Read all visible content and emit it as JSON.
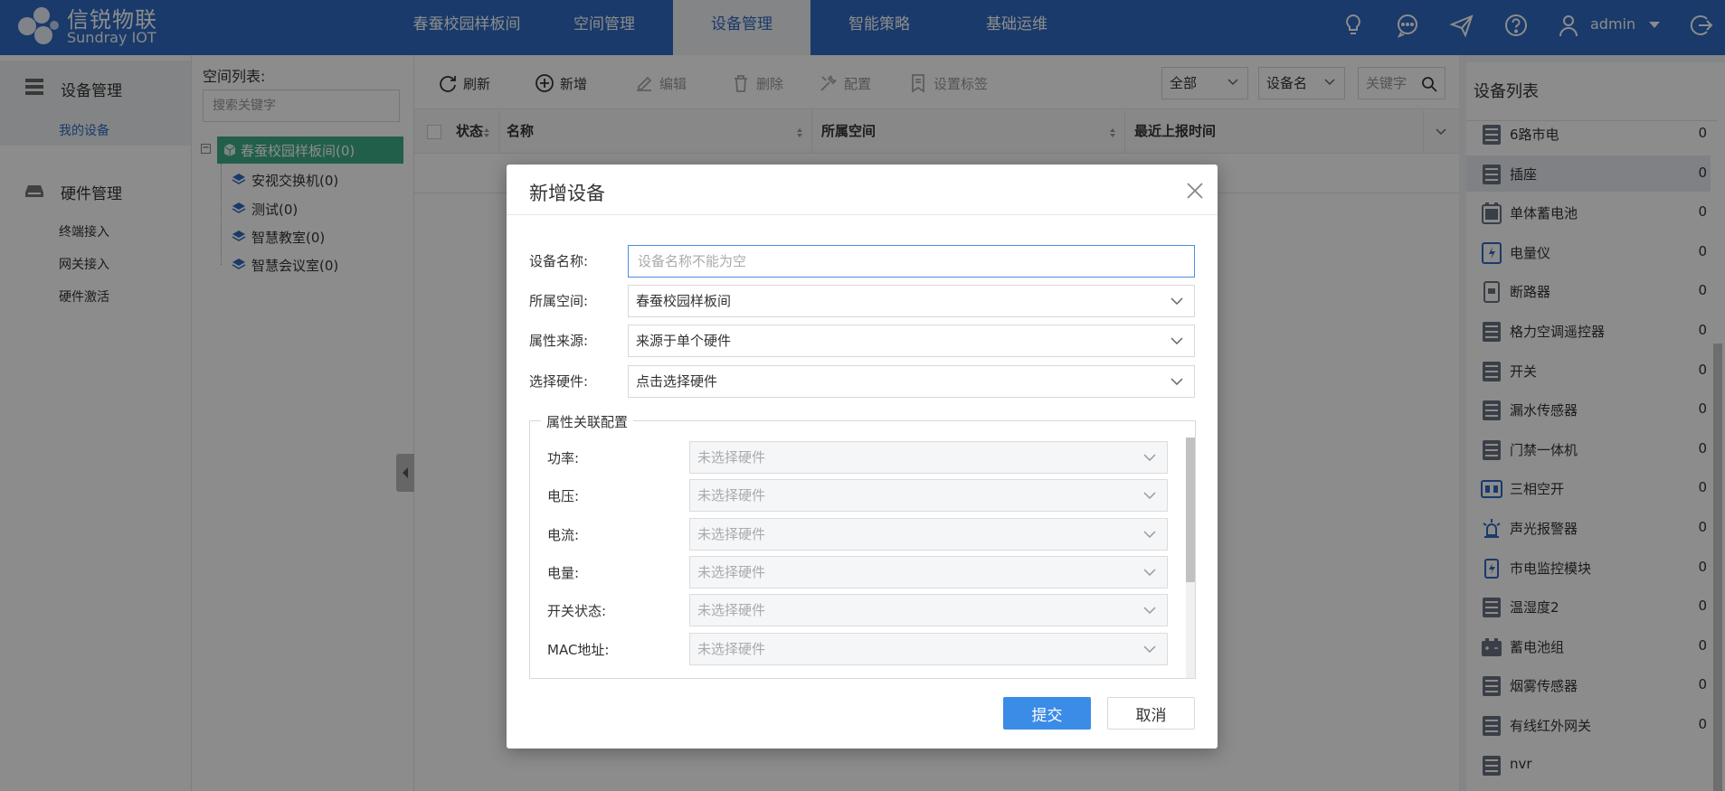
{
  "brand": {
    "name_cn": "信锐物联",
    "name_en": "Sundray IOT"
  },
  "nav": {
    "items": [
      "春蚕校园样板间",
      "空间管理",
      "设备管理",
      "智能策略",
      "基础运维"
    ],
    "active_index": 2
  },
  "user": {
    "name": "admin"
  },
  "sidebar": {
    "groups": [
      {
        "label": "设备管理",
        "icon": "list-icon",
        "items": [
          "我的设备"
        ]
      },
      {
        "label": "硬件管理",
        "icon": "hardware-icon",
        "items": [
          "终端接入",
          "网关接入",
          "硬件激活"
        ]
      }
    ],
    "active_item": "我的设备"
  },
  "space_tree": {
    "title": "空间列表:",
    "search_placeholder": "搜索关键字",
    "root": "春蚕校园样板间(0)",
    "children": [
      "安视交换机(0)",
      "测试(0)",
      "智慧教室(0)",
      "智慧会议室(0)"
    ]
  },
  "toolbar": {
    "refresh": "刷新",
    "add": "新增",
    "edit": "编辑",
    "delete": "删除",
    "config": "配置",
    "set_tag": "设置标签",
    "filter_all": "全部",
    "filter_field": "设备名",
    "keyword_placeholder": "关键字"
  },
  "grid": {
    "columns": [
      "状态",
      "名称",
      "所属空间",
      "最近上报时间"
    ]
  },
  "device_list": {
    "title": "设备列表",
    "items": [
      {
        "label": "6路市电",
        "count": "0",
        "icon": "server-icon"
      },
      {
        "label": "插座",
        "count": "0",
        "icon": "server-icon",
        "active": true
      },
      {
        "label": "单体蓄电池",
        "count": "0",
        "icon": "battery-icon"
      },
      {
        "label": "电量仪",
        "count": "0",
        "icon": "meter-icon"
      },
      {
        "label": "断路器",
        "count": "0",
        "icon": "breaker-icon"
      },
      {
        "label": "格力空调遥控器",
        "count": "0",
        "icon": "server-icon"
      },
      {
        "label": "开关",
        "count": "0",
        "icon": "server-icon"
      },
      {
        "label": "漏水传感器",
        "count": "0",
        "icon": "server-icon"
      },
      {
        "label": "门禁一体机",
        "count": "0",
        "icon": "server-icon"
      },
      {
        "label": "三相空开",
        "count": "0",
        "icon": "switch-icon"
      },
      {
        "label": "声光报警器",
        "count": "0",
        "icon": "alarm-icon"
      },
      {
        "label": "市电监控模块",
        "count": "0",
        "icon": "power-module-icon"
      },
      {
        "label": "温湿度2",
        "count": "0",
        "icon": "server-icon"
      },
      {
        "label": "蓄电池组",
        "count": "0",
        "icon": "battery-group-icon"
      },
      {
        "label": "烟雾传感器",
        "count": "0",
        "icon": "server-icon"
      },
      {
        "label": "有线红外网关",
        "count": "0",
        "icon": "server-icon"
      },
      {
        "label": "nvr",
        "count": "",
        "icon": "server-icon"
      }
    ]
  },
  "modal": {
    "title": "新增设备",
    "fields": {
      "device_name_label": "设备名称:",
      "device_name_placeholder": "设备名称不能为空",
      "space_label": "所属空间:",
      "space_value": "春蚕校园样板间",
      "source_label": "属性来源:",
      "source_value": "来源于单个硬件",
      "hardware_label": "选择硬件:",
      "hardware_value": "点击选择硬件"
    },
    "attr_config": {
      "legend": "属性关联配置",
      "rows": [
        {
          "label": "功率:",
          "value": "未选择硬件"
        },
        {
          "label": "电压:",
          "value": "未选择硬件"
        },
        {
          "label": "电流:",
          "value": "未选择硬件"
        },
        {
          "label": "电量:",
          "value": "未选择硬件"
        },
        {
          "label": "开关状态:",
          "value": "未选择硬件"
        },
        {
          "label": "MAC地址:",
          "value": "未选择硬件"
        }
      ]
    },
    "submit": "提交",
    "cancel": "取消"
  },
  "colors": {
    "primary": "#2f6bc1",
    "tree_active": "#3fae89",
    "submit": "#3b8ce6"
  }
}
